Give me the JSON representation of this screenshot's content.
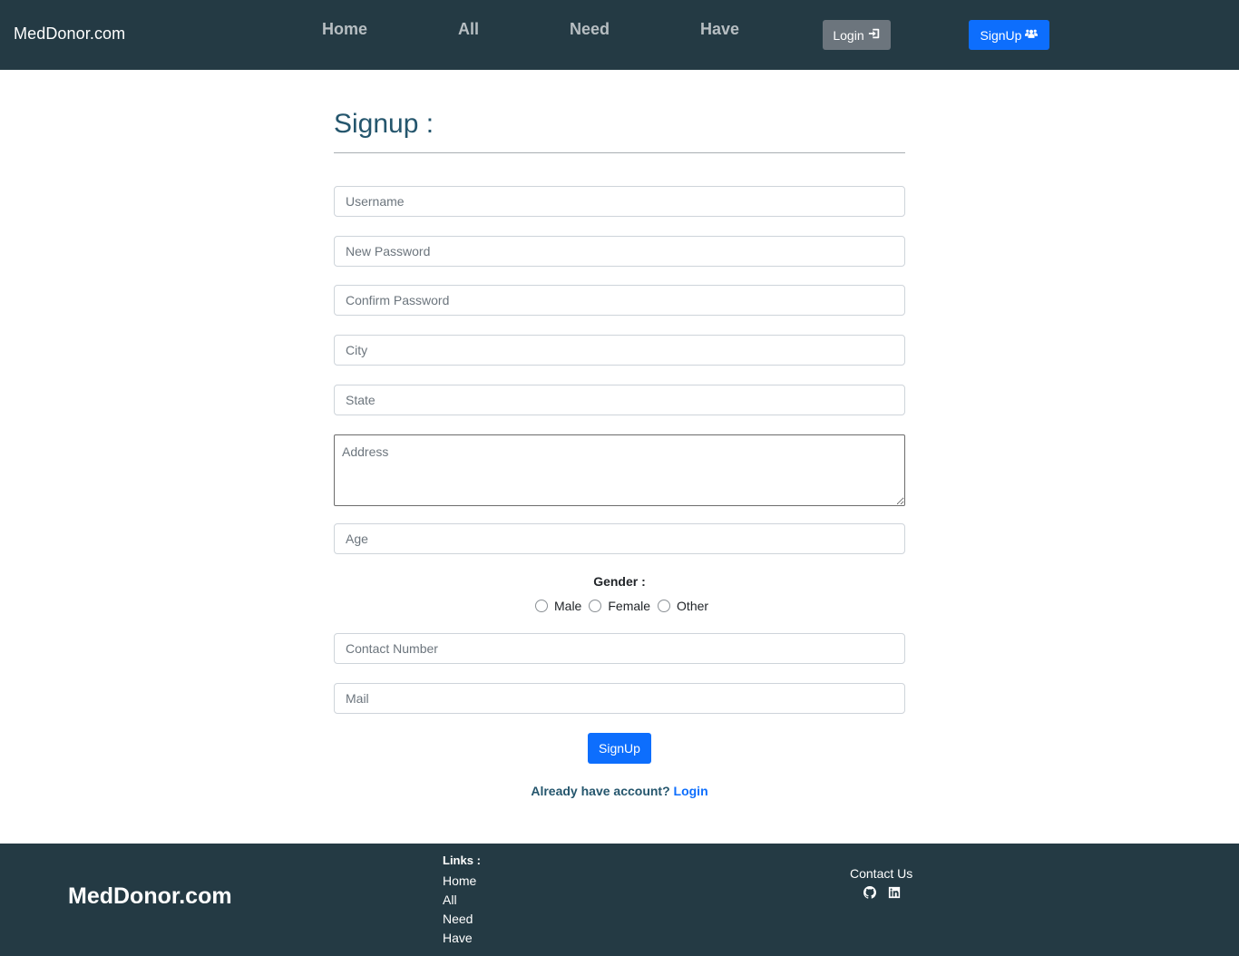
{
  "navbar": {
    "brand": "MedDonor.com",
    "links": [
      "Home",
      "All",
      "Need",
      "Have"
    ],
    "login_label": "Login",
    "login_icon": "sign-in-icon",
    "signup_label": "SignUp",
    "signup_icon": "users-icon"
  },
  "form": {
    "title": "Signup :",
    "placeholders": {
      "username": "Username",
      "new_password": "New Password",
      "confirm_password": "Confirm Password",
      "city": "City",
      "state": "State",
      "address": "Address",
      "age": "Age",
      "contact": "Contact Number",
      "mail": "Mail"
    },
    "gender_label": "Gender :",
    "gender_options": [
      "Male",
      "Female",
      "Other"
    ],
    "submit_label": "SignUp",
    "already_text": "Already have account?",
    "login_link": "Login"
  },
  "footer": {
    "brand": "MedDonor.com",
    "links_title": "Links :",
    "links": [
      "Home",
      "All",
      "Need",
      "Have"
    ],
    "contact_title": "Contact Us",
    "social_icons": [
      "github-icon",
      "linkedin-icon"
    ]
  },
  "colors": {
    "navbar_bg": "#243a44",
    "primary": "#0d6efd",
    "secondary": "#6c757d",
    "title": "#25566d"
  }
}
